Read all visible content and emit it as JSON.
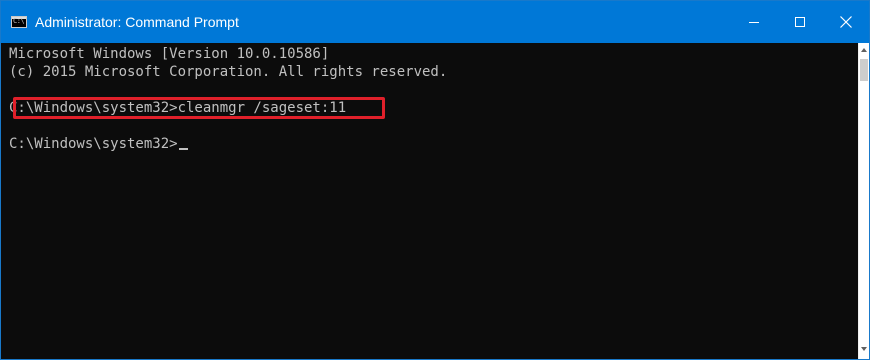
{
  "window": {
    "title": "Administrator: Command Prompt",
    "icon": "cmd-icon",
    "icon_text": "C:\\",
    "title_bar_color": "#0078d7",
    "console_background": "#0c0c0c",
    "console_text_color": "#c0c0c0"
  },
  "controls": {
    "minimize_icon": "minimize-icon",
    "maximize_icon": "maximize-icon",
    "close_icon": "close-icon"
  },
  "console": {
    "lines": [
      "Microsoft Windows [Version 10.0.10586]",
      "(c) 2015 Microsoft Corporation. All rights reserved.",
      "C:\\Windows\\system32>cleanmgr /sageset:11",
      "C:\\Windows\\system32>"
    ],
    "highlight_color": "#e0202a"
  },
  "scrollbar": {
    "up_icon": "scroll-up-icon",
    "down_icon": "scroll-down-icon"
  }
}
